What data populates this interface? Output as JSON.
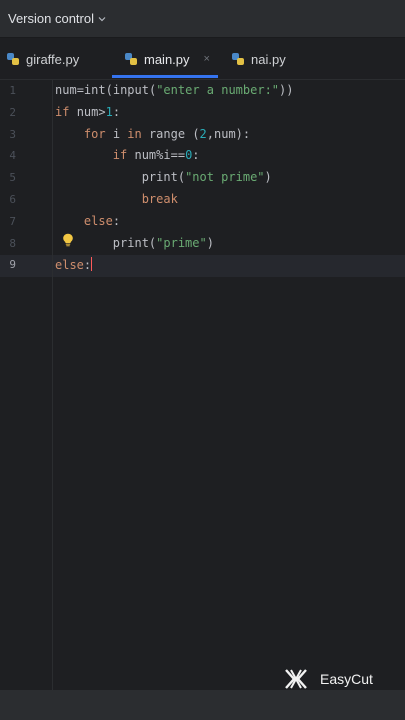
{
  "topbar": {
    "project_label": "Version control"
  },
  "tabs": [
    {
      "label": "giraffe.py",
      "active": false
    },
    {
      "label": "main.py",
      "active": true,
      "close_glyph": "×"
    },
    {
      "label": "nai.py",
      "active": false
    }
  ],
  "editor": {
    "line_numbers": [
      "1",
      "2",
      "3",
      "4",
      "5",
      "6",
      "7",
      "8",
      "9"
    ],
    "lines": [
      {
        "indent": "",
        "tokens": [
          [
            "fn",
            "num"
          ],
          [
            "fn",
            "="
          ],
          [
            "fn",
            "int"
          ],
          [
            "fn",
            "("
          ],
          [
            "fn",
            "input"
          ],
          [
            "fn",
            "("
          ],
          [
            "str",
            "\"enter a number:\""
          ],
          [
            "fn",
            "))"
          ]
        ]
      },
      {
        "indent": "",
        "tokens": [
          [
            "kw",
            "if "
          ],
          [
            "fn",
            "num"
          ],
          [
            "fn",
            ">"
          ],
          [
            "num",
            "1"
          ],
          [
            "fn",
            ":"
          ]
        ]
      },
      {
        "indent": "    ",
        "tokens": [
          [
            "kw",
            "for "
          ],
          [
            "fn",
            "i "
          ],
          [
            "kw",
            "in "
          ],
          [
            "fn",
            "range "
          ],
          [
            "fn",
            "("
          ],
          [
            "num",
            "2"
          ],
          [
            "fn",
            ",num):"
          ]
        ]
      },
      {
        "indent": "        ",
        "tokens": [
          [
            "kw",
            "if "
          ],
          [
            "fn",
            "num%i=="
          ],
          [
            "num",
            "0"
          ],
          [
            "fn",
            ":"
          ]
        ]
      },
      {
        "indent": "            ",
        "tokens": [
          [
            "fn",
            "print"
          ],
          [
            "fn",
            "("
          ],
          [
            "str",
            "\"not prime\""
          ],
          [
            "fn",
            ")"
          ]
        ]
      },
      {
        "indent": "            ",
        "tokens": [
          [
            "kw",
            "break"
          ]
        ]
      },
      {
        "indent": "    ",
        "tokens": [
          [
            "kw",
            "else"
          ],
          [
            "fn",
            ":"
          ]
        ]
      },
      {
        "indent": "        ",
        "tokens": [
          [
            "fn",
            "print"
          ],
          [
            "fn",
            "("
          ],
          [
            "str",
            "\"prime\""
          ],
          [
            "fn",
            ")"
          ]
        ]
      },
      {
        "indent": "",
        "tokens": [
          [
            "kw",
            "else"
          ],
          [
            "fn",
            ":"
          ]
        ]
      }
    ],
    "current_line": "9"
  },
  "icons": {
    "bulb": "lightbulb-icon",
    "python": "python-file-icon",
    "chevron": "chevron-down-icon",
    "watermark": "easycut-logo-icon"
  },
  "watermark": {
    "text": "EasyCut"
  },
  "colors": {
    "accent": "#3574f0",
    "keyword": "#cf8e6d",
    "string": "#6aab73",
    "number": "#2aacb8",
    "bulb": "#f2c744"
  }
}
